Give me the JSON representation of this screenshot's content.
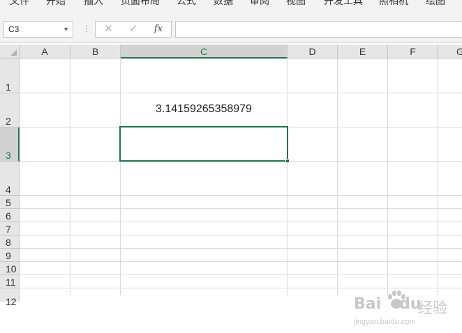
{
  "ribbon": {
    "tabs": [
      "文件",
      "开始",
      "插入",
      "页面布局",
      "公式",
      "数据",
      "审阅",
      "视图",
      "开发工具",
      "照相机",
      "绘图"
    ]
  },
  "formula_bar": {
    "name_box": "C3",
    "cancel_icon": "✕",
    "enter_icon": "✓",
    "function_icon": "fx",
    "formula": ""
  },
  "sheet": {
    "columns": [
      "A",
      "B",
      "C",
      "D",
      "E",
      "F",
      "G"
    ],
    "rows": [
      "1",
      "2",
      "3",
      "4",
      "5",
      "6",
      "7",
      "8",
      "9",
      "10",
      "11",
      "12"
    ],
    "selected_column": "C",
    "selected_row": "3",
    "cells": {
      "C2": "3.14159265358979",
      "C3": ""
    },
    "accent_color": "#217346"
  },
  "watermark": {
    "logo_text": "Bai",
    "logo_text_2": "du",
    "product": "经验",
    "url": "jingyan.baidu.com"
  }
}
